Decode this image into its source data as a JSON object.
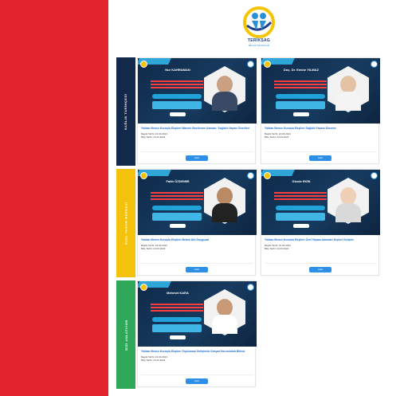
{
  "brand": {
    "name": "TERİKSAG",
    "tagline": "BEYAZ SAYFALAR",
    "accent_red": "#e2222c",
    "navy": "#1d3f8c"
  },
  "sections": [
    {
      "label": "SAĞLIK TARİHÇESİ",
      "color": "#13294b"
    },
    {
      "label": "ÖZEL YAŞAM MERKEZİ",
      "color": "#f4c20d"
    },
    {
      "label": "BİZİ ANLATIYOR",
      "color": "#2fa85a"
    }
  ],
  "cards": [
    {
      "name": "Nur KAHRAMAN",
      "title": "Yoktan Bence Kuruşlu Ekşileri Manevi Beslenme Uzmanı: Sağlıklı Yaşam Önerileri",
      "meta1": "Başlık Tarihi: 23.03.2024",
      "meta2": "Bitiş Tarihi: 24.03.2024",
      "button": "Katıl"
    },
    {
      "name": "Doç. Dr. Emine YILMAZ",
      "title": "Yoktan Bence Kuruşlu Ekşileri Sağlıklı Yaşam Dönemi",
      "meta1": "Başlık Tarihi: 23.03.2024",
      "meta2": "Bitiş Tarihi: 24.03.2024",
      "button": "Katıl"
    },
    {
      "name": "Fatih ÖZDEMİR",
      "title": "Yoktan Bence Kuruşlu Ekşileri Bebek Altı Duygusal",
      "meta1": "Başlık Tarihi: 23.03.2024",
      "meta2": "Bitiş Tarihi: 24.03.2024",
      "button": "Katıl"
    },
    {
      "name": "Gözde EKİN",
      "title": "Yoktan Bence Kuruşlu Ekşileri Özel Yaşam Adımları Kişisel Gelişim",
      "meta1": "Başlık Tarihi: 23.03.2024",
      "meta2": "Bitiş Tarihi: 24.03.2024",
      "button": "Katıl"
    },
    {
      "name": "Mehmet KARA",
      "title": "Yoktan Bence Kuruşlu Ekşileri Toplumsal Gelişimde Sosyal Sorumluluk Bilinci",
      "meta1": "Başlık Tarihi: 23.03.2024",
      "meta2": "Bitiş Tarihi: 24.03.2024",
      "button": "Katıl"
    }
  ]
}
